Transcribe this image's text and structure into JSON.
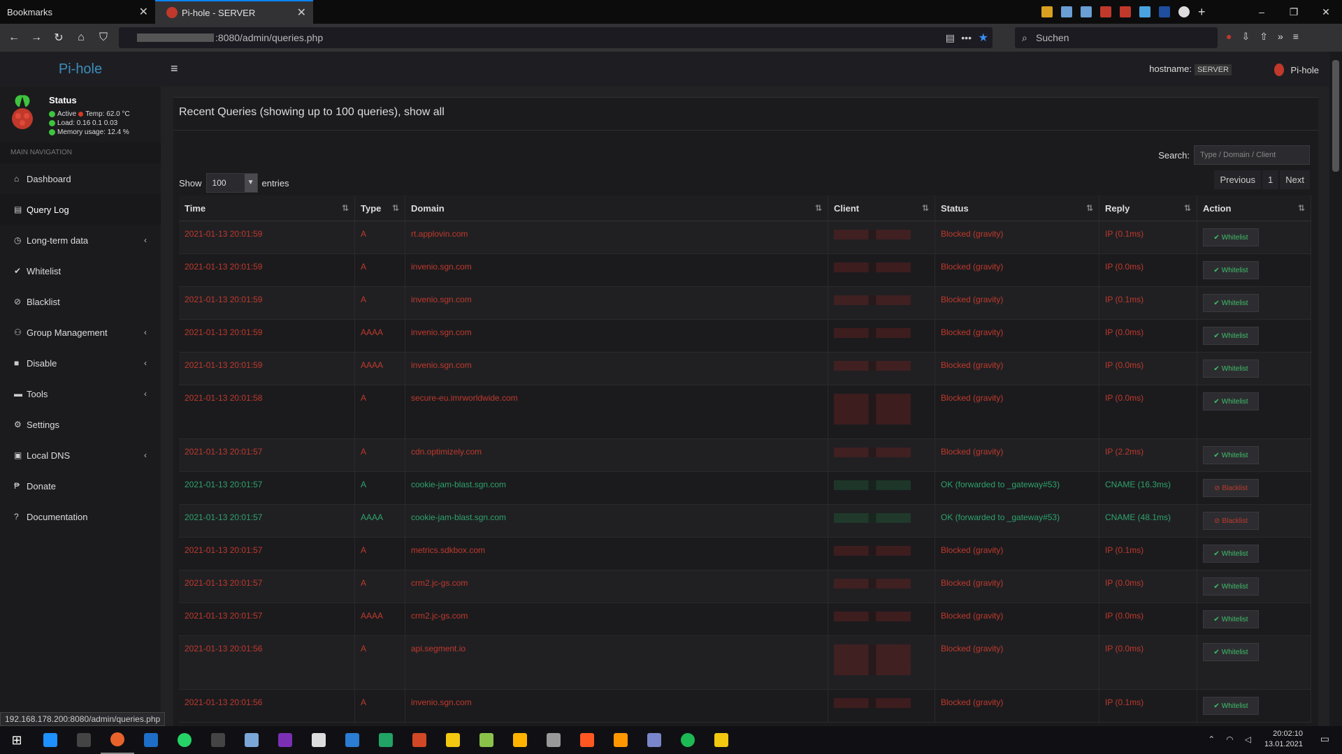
{
  "browser": {
    "tabs": [
      {
        "label": "Bookmarks",
        "active": false
      },
      {
        "label": "Pi-hole - SERVER",
        "active": true
      }
    ],
    "url_suffix": ":8080/admin/queries.php",
    "search_placeholder": "Suchen",
    "status_url": "192.168.178.200:8080/admin/queries.php",
    "window_controls": [
      "–",
      "❐",
      "✕"
    ]
  },
  "app": {
    "logo_pi": "Pi-",
    "logo_hole": "hole",
    "status_title": "Status",
    "status_active": "Active",
    "status_temp": "Temp: 62.0 °C",
    "status_load": "Load:  0.16  0.1  0.03",
    "status_memory": "Memory usage:  12.4 %",
    "nav_header": "MAIN NAVIGATION",
    "nav": [
      {
        "label": "Dashboard",
        "icon": "home-icon",
        "glyph": "⌂",
        "chevron": false
      },
      {
        "label": "Query Log",
        "icon": "file-icon",
        "glyph": "▤",
        "chevron": false,
        "active": true
      },
      {
        "label": "Long-term data",
        "icon": "clock-icon",
        "glyph": "◷",
        "chevron": true
      },
      {
        "label": "Whitelist",
        "icon": "check-circle-icon",
        "glyph": "✔",
        "chevron": false
      },
      {
        "label": "Blacklist",
        "icon": "ban-icon",
        "glyph": "⊘",
        "chevron": false
      },
      {
        "label": "Group Management",
        "icon": "users-icon",
        "glyph": "⚇",
        "chevron": true
      },
      {
        "label": "Disable",
        "icon": "stop-icon",
        "glyph": "■",
        "chevron": true
      },
      {
        "label": "Tools",
        "icon": "folder-icon",
        "glyph": "▬",
        "chevron": true
      },
      {
        "label": "Settings",
        "icon": "gears-icon",
        "glyph": "⚙",
        "chevron": false
      },
      {
        "label": "Local DNS",
        "icon": "address-book-icon",
        "glyph": "▣",
        "chevron": true
      },
      {
        "label": "Donate",
        "icon": "paypal-icon",
        "glyph": "₱",
        "chevron": false
      },
      {
        "label": "Documentation",
        "icon": "question-circle-icon",
        "glyph": "?",
        "chevron": false
      }
    ],
    "hostname_label": "hostname:",
    "hostname_value": "SERVER",
    "user_label": "Pi-hole",
    "colors": {
      "blocked": "#c0392b",
      "ok": "#2ea36b",
      "accent": "#3c8dbc"
    }
  },
  "queries": {
    "title": "Recent Queries (showing up to 100 queries), show all",
    "show_label": "Show",
    "show_value": "100",
    "entries_label": "entries",
    "search_label": "Search:",
    "search_placeholder": "Type / Domain / Client",
    "pager": {
      "previous": "Previous",
      "page": "1",
      "next": "Next"
    },
    "columns": [
      "Time",
      "Type",
      "Domain",
      "Client",
      "Status",
      "Reply",
      "Action"
    ],
    "rows": [
      {
        "time": "2021-01-13 20:01:59",
        "type": "A",
        "domain": "rt.applovin.com",
        "status": "Blocked (gravity)",
        "reply": "IP (0.1ms)",
        "action": "Whitelist",
        "kind": "blocked",
        "tall": false
      },
      {
        "time": "2021-01-13 20:01:59",
        "type": "A",
        "domain": "invenio.sgn.com",
        "status": "Blocked (gravity)",
        "reply": "IP (0.0ms)",
        "action": "Whitelist",
        "kind": "blocked",
        "tall": false
      },
      {
        "time": "2021-01-13 20:01:59",
        "type": "A",
        "domain": "invenio.sgn.com",
        "status": "Blocked (gravity)",
        "reply": "IP (0.1ms)",
        "action": "Whitelist",
        "kind": "blocked",
        "tall": false
      },
      {
        "time": "2021-01-13 20:01:59",
        "type": "AAAA",
        "domain": "invenio.sgn.com",
        "status": "Blocked (gravity)",
        "reply": "IP (0.0ms)",
        "action": "Whitelist",
        "kind": "blocked",
        "tall": false
      },
      {
        "time": "2021-01-13 20:01:59",
        "type": "AAAA",
        "domain": "invenio.sgn.com",
        "status": "Blocked (gravity)",
        "reply": "IP (0.0ms)",
        "action": "Whitelist",
        "kind": "blocked",
        "tall": false
      },
      {
        "time": "2021-01-13 20:01:58",
        "type": "A",
        "domain": "secure-eu.imrworldwide.com",
        "status": "Blocked (gravity)",
        "reply": "IP (0.0ms)",
        "action": "Whitelist",
        "kind": "blocked",
        "tall": true
      },
      {
        "time": "2021-01-13 20:01:57",
        "type": "A",
        "domain": "cdn.optimizely.com",
        "status": "Blocked (gravity)",
        "reply": "IP (2.2ms)",
        "action": "Whitelist",
        "kind": "blocked",
        "tall": false
      },
      {
        "time": "2021-01-13 20:01:57",
        "type": "A",
        "domain": "cookie-jam-blast.sgn.com",
        "status": "OK (forwarded to _gateway#53)",
        "reply": "CNAME (16.3ms)",
        "action": "Blacklist",
        "kind": "ok",
        "tall": false
      },
      {
        "time": "2021-01-13 20:01:57",
        "type": "AAAA",
        "domain": "cookie-jam-blast.sgn.com",
        "status": "OK (forwarded to _gateway#53)",
        "reply": "CNAME (48.1ms)",
        "action": "Blacklist",
        "kind": "ok",
        "tall": false
      },
      {
        "time": "2021-01-13 20:01:57",
        "type": "A",
        "domain": "metrics.sdkbox.com",
        "status": "Blocked (gravity)",
        "reply": "IP (0.1ms)",
        "action": "Whitelist",
        "kind": "blocked",
        "tall": false
      },
      {
        "time": "2021-01-13 20:01:57",
        "type": "A",
        "domain": "crm2.jc-gs.com",
        "status": "Blocked (gravity)",
        "reply": "IP (0.0ms)",
        "action": "Whitelist",
        "kind": "blocked",
        "tall": false
      },
      {
        "time": "2021-01-13 20:01:57",
        "type": "AAAA",
        "domain": "crm2.jc-gs.com",
        "status": "Blocked (gravity)",
        "reply": "IP (0.0ms)",
        "action": "Whitelist",
        "kind": "blocked",
        "tall": false
      },
      {
        "time": "2021-01-13 20:01:56",
        "type": "A",
        "domain": "api.segment.io",
        "status": "Blocked (gravity)",
        "reply": "IP (0.0ms)",
        "action": "Whitelist",
        "kind": "blocked",
        "tall": true
      },
      {
        "time": "2021-01-13 20:01:56",
        "type": "A",
        "domain": "invenio.sgn.com",
        "status": "Blocked (gravity)",
        "reply": "IP (0.1ms)",
        "action": "Whitelist",
        "kind": "blocked",
        "tall": false
      }
    ]
  },
  "taskbar": {
    "time": "20:02:10",
    "date": "13.01.2021",
    "apps": [
      "#1e90ff",
      "#444",
      "#e8632b",
      "#1e6ec8",
      "#25d366",
      "#444",
      "#7aa7d8",
      "#7b2fb5",
      "#ddd",
      "#2b7cd3",
      "#21a366",
      "#d24726",
      "#f2c811",
      "#8bc34a",
      "#ffb300",
      "#999",
      "#ff5722",
      "#ff9800",
      "#7986cb",
      "#1db954",
      "#f2c811"
    ]
  }
}
